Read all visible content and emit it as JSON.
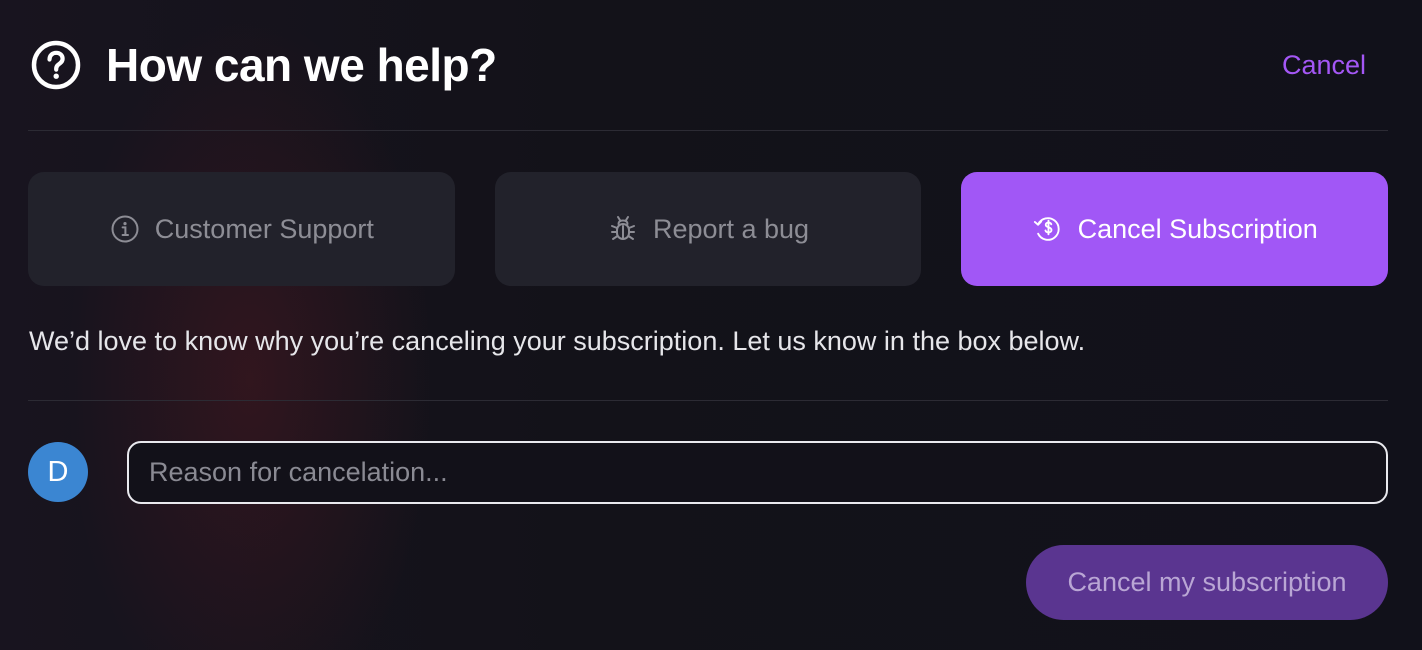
{
  "header": {
    "title": "How can we help?",
    "cancel_label": "Cancel",
    "icon": "question-circle-icon"
  },
  "options": [
    {
      "label": "Customer Support",
      "icon": "info-circle-icon",
      "selected": false
    },
    {
      "label": "Report a bug",
      "icon": "bug-icon",
      "selected": false
    },
    {
      "label": "Cancel Subscription",
      "icon": "dollar-refresh-icon",
      "selected": true
    }
  ],
  "prompt": "We’d love to know why you’re canceling your subscription. Let us know in the box below.",
  "avatar": {
    "initial": "D",
    "color": "#3b86d2"
  },
  "reason_input": {
    "value": "",
    "placeholder": "Reason for cancelation..."
  },
  "submit_label": "Cancel my subscription",
  "colors": {
    "accent": "#a157f6",
    "link": "#a457f5",
    "submit_disabled": "#5a3590"
  }
}
